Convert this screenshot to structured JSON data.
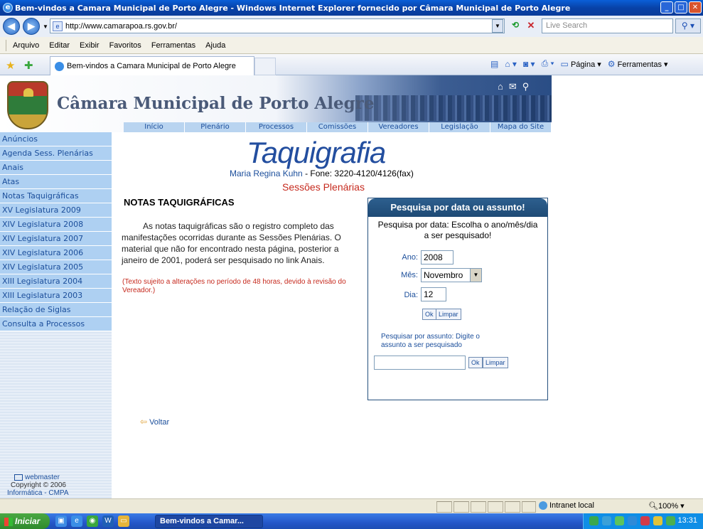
{
  "window": {
    "title": "Bem-vindos a Camara Municipal de Porto Alegre - Windows Internet Explorer fornecido por Câmara Municipal de Porto Alegre"
  },
  "browser": {
    "url": "http://www.camarapoa.rs.gov.br/",
    "search_placeholder": "Live Search",
    "menu": [
      "Arquivo",
      "Editar",
      "Exibir",
      "Favoritos",
      "Ferramentas",
      "Ajuda"
    ],
    "tab_title": "Bem-vindos a Camara Municipal de Porto Alegre",
    "cmd_pagina": "Página",
    "cmd_ferramentas": "Ferramentas"
  },
  "site": {
    "title": "Câmara Municipal de Porto Alegre",
    "topnav": [
      "Início",
      "Plenário",
      "Processos",
      "Comissões",
      "Vereadores",
      "Legislação",
      "Mapa do Site"
    ],
    "sidebar": [
      "Anúncios",
      "Agenda Sess. Plenárias",
      "Anais",
      "Atas",
      "Notas Taquigráficas",
      "XV Legislatura 2009",
      "XIV Legislatura 2008",
      "XIV Legislatura 2007",
      "XIV Legislatura 2006",
      "XIV Legislatura 2005",
      "XIII Legislatura 2004",
      "XIII Legislatura 2003",
      "Relação de Siglas",
      "Consulta a Processos"
    ],
    "footer": {
      "webmaster": "webmaster",
      "copyright": "Copyright © 2006",
      "informatica": "Informática - CMPA"
    }
  },
  "content": {
    "heading": "Taquigrafia",
    "contact_name": "Maria Regina Kuhn",
    "contact_phone": " - Fone: 3220-4120/4126(fax)",
    "section": "Sessões Plenárias",
    "notes_title": "NOTAS TAQUIGRÁFICAS",
    "notes_text": "As notas taquigráficas são o registro completo das manifestações ocorridas durante as Sessões Plenárias. O material que não for encontrado nesta página, posterior a janeiro de 2001, poderá ser pesquisado no link Anais.",
    "notes_warning": "(Texto sujeito a alterações no período de 48 horas, devido à revisão do Vereador.)",
    "back_link": "Voltar"
  },
  "search_panel": {
    "header": "Pesquisa por data ou assunto!",
    "description": "Pesquisa por data: Escolha o ano/mês/dia a ser pesquisado!",
    "ano_label": "Ano:",
    "ano_value": "2008",
    "mes_label": "Mês:",
    "mes_value": "Novembro",
    "dia_label": "Dia:",
    "dia_value": "12",
    "ok_label": "Ok",
    "limpar_label": "Limpar",
    "subject_description": "Pesquisar por assunto: Digite o assunto a ser pesquisado",
    "subject_value": ""
  },
  "statusbar": {
    "zone": "Intranet local",
    "zoom": "100%"
  },
  "taskbar": {
    "start": "Iniciar",
    "task_label": "Bem-vindos a Camar...",
    "time": "13:31"
  }
}
